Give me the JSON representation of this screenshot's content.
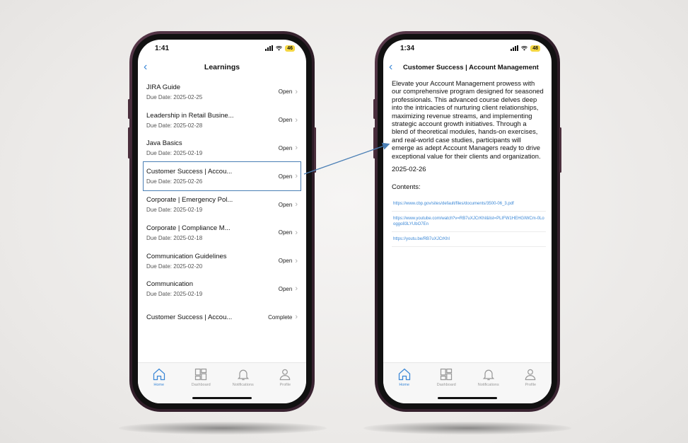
{
  "colors": {
    "accent": "#3a87d6",
    "selection_outline": "#4a7fb5",
    "battery": "#f5d742"
  },
  "left_phone": {
    "status": {
      "time": "1:41",
      "battery": "46"
    },
    "nav_title": "Learnings",
    "items": [
      {
        "title": "JIRA Guide",
        "due": "Due Date: 2025-02-25",
        "status": "Open"
      },
      {
        "title": "Leadership in Retail Busine...",
        "due": "Due Date: 2025-02-28",
        "status": "Open"
      },
      {
        "title": "Java Basics",
        "due": "Due Date: 2025-02-19",
        "status": "Open"
      },
      {
        "title": "Customer Success | Accou...",
        "due": "Due Date: 2025-02-26",
        "status": "Open"
      },
      {
        "title": "Corporate | Emergency Pol...",
        "due": "Due Date: 2025-02-19",
        "status": "Open"
      },
      {
        "title": "Corporate | Compliance M...",
        "due": "Due Date: 2025-02-18",
        "status": "Open"
      },
      {
        "title": "Communication Guidelines",
        "due": "Due Date: 2025-02-20",
        "status": "Open"
      },
      {
        "title": "Communication",
        "due": "Due Date: 2025-02-19",
        "status": "Open"
      },
      {
        "title": "Customer Success | Accou...",
        "due": "",
        "status": "Complete"
      }
    ]
  },
  "right_phone": {
    "status": {
      "time": "1:34",
      "battery": "48"
    },
    "nav_title": "Customer Success | Account Management",
    "description": "Elevate your Account Management prowess with our comprehensive program designed for seasoned professionals. This advanced course delves deep into the intricacies of nurturing client relationships, maximizing revenue streams, and implementing strategic account growth initiatives. Through a blend of theoretical modules, hands-on exercises, and real-world case studies, participants will emerge as adept Account Managers ready to drive exceptional value for their clients and organization.",
    "date": "2025-02-26",
    "contents_label": "Contents:",
    "links": [
      "https://www.cbp.gov/sites/default/files/documents/3500-06_3.pdf",
      "https://www.youtube.com/watch?v=RB7uXJCrKhI&list=PLIFW1HEHGIWCm-0Looggo83LYUbO7En",
      "https://youtu.be/RB7uXJCrKhI"
    ]
  },
  "tabbar": [
    {
      "label": "Home",
      "icon": "home-icon"
    },
    {
      "label": "Dashboard",
      "icon": "dashboard-icon"
    },
    {
      "label": "Notifications",
      "icon": "bell-icon"
    },
    {
      "label": "Profile",
      "icon": "profile-icon"
    }
  ]
}
